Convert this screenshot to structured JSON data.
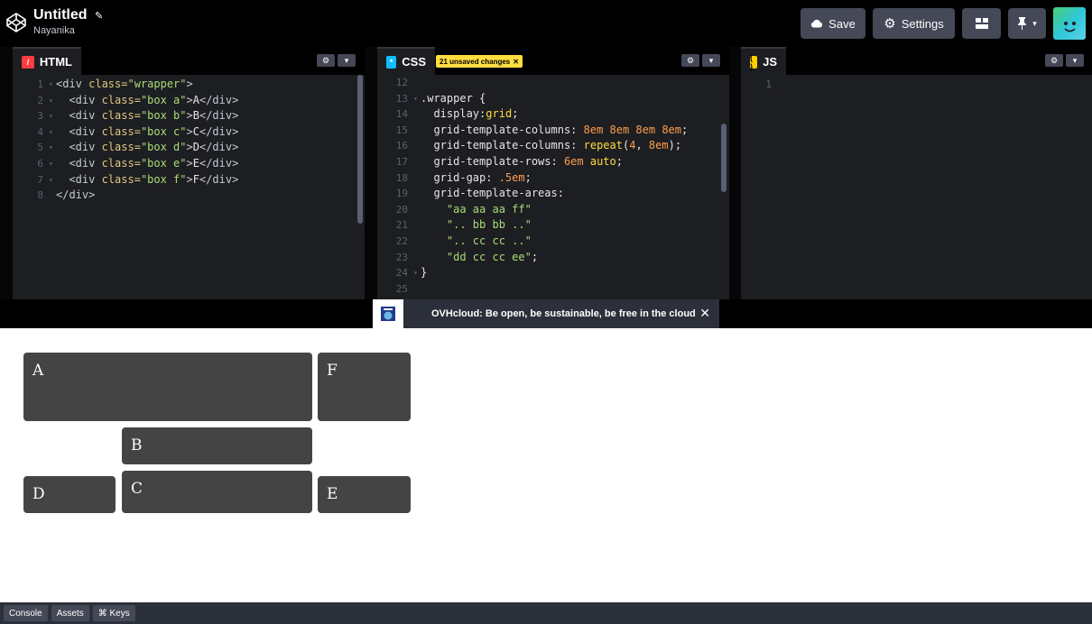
{
  "header": {
    "title": "Untitled",
    "edit_icon": "pencil-icon",
    "author": "Nayanika",
    "save_label": "Save",
    "settings_label": "Settings",
    "layout_icon": "layout-icon",
    "pin_icon": "pin-icon",
    "avatar": "user-avatar"
  },
  "editors": {
    "html": {
      "label": "HTML",
      "color": "#ff3c41",
      "lines": [
        {
          "n": "1",
          "fold": true,
          "parts": [
            [
              "tag",
              "<div "
            ],
            [
              "attr",
              "class="
            ],
            [
              "str",
              "\"wrapper\""
            ],
            [
              "tag",
              ">"
            ]
          ]
        },
        {
          "n": "2",
          "fold": true,
          "parts": [
            [
              "plain",
              "  "
            ],
            [
              "tag",
              "<div "
            ],
            [
              "attr",
              "class="
            ],
            [
              "str",
              "\"box a\""
            ],
            [
              "tag",
              ">"
            ],
            [
              "plain",
              "A"
            ],
            [
              "tag",
              "</div>"
            ]
          ]
        },
        {
          "n": "3",
          "fold": true,
          "parts": [
            [
              "plain",
              "  "
            ],
            [
              "tag",
              "<div "
            ],
            [
              "attr",
              "class="
            ],
            [
              "str",
              "\"box b\""
            ],
            [
              "tag",
              ">"
            ],
            [
              "plain",
              "B"
            ],
            [
              "tag",
              "</div>"
            ]
          ]
        },
        {
          "n": "4",
          "fold": true,
          "parts": [
            [
              "plain",
              "  "
            ],
            [
              "tag",
              "<div "
            ],
            [
              "attr",
              "class="
            ],
            [
              "str",
              "\"box c\""
            ],
            [
              "tag",
              ">"
            ],
            [
              "plain",
              "C"
            ],
            [
              "tag",
              "</div>"
            ]
          ]
        },
        {
          "n": "5",
          "fold": true,
          "parts": [
            [
              "plain",
              "  "
            ],
            [
              "tag",
              "<div "
            ],
            [
              "attr",
              "class="
            ],
            [
              "str",
              "\"box d\""
            ],
            [
              "tag",
              ">"
            ],
            [
              "plain",
              "D"
            ],
            [
              "tag",
              "</div>"
            ]
          ]
        },
        {
          "n": "6",
          "fold": true,
          "parts": [
            [
              "plain",
              "  "
            ],
            [
              "tag",
              "<div "
            ],
            [
              "attr",
              "class="
            ],
            [
              "str",
              "\"box e\""
            ],
            [
              "tag",
              ">"
            ],
            [
              "plain",
              "E"
            ],
            [
              "tag",
              "</div>"
            ]
          ]
        },
        {
          "n": "7",
          "fold": true,
          "parts": [
            [
              "plain",
              "  "
            ],
            [
              "tag",
              "<div "
            ],
            [
              "attr",
              "class="
            ],
            [
              "str",
              "\"box f\""
            ],
            [
              "tag",
              ">"
            ],
            [
              "plain",
              "F"
            ],
            [
              "tag",
              "</div>"
            ]
          ]
        },
        {
          "n": "8",
          "fold": false,
          "parts": [
            [
              "tag",
              "</div>"
            ]
          ]
        }
      ]
    },
    "css": {
      "label": "CSS",
      "color": "#0ebeff",
      "badge": "21 unsaved changes",
      "lines": [
        {
          "n": "12",
          "fold": false,
          "parts": []
        },
        {
          "n": "13",
          "fold": true,
          "parts": [
            [
              "sel",
              ".wrapper "
            ],
            [
              "plain",
              "{"
            ]
          ]
        },
        {
          "n": "14",
          "fold": false,
          "parts": [
            [
              "plain",
              "  "
            ],
            [
              "prop",
              "display"
            ],
            [
              "plain",
              ":"
            ],
            [
              "cssval",
              "grid"
            ],
            [
              "plain",
              ";"
            ]
          ]
        },
        {
          "n": "15",
          "fold": false,
          "parts": [
            [
              "plain",
              "  "
            ],
            [
              "prop",
              "grid-template-columns"
            ],
            [
              "plain",
              ": "
            ],
            [
              "num",
              "8em 8em 8em 8em"
            ],
            [
              "plain",
              ";"
            ]
          ]
        },
        {
          "n": "16",
          "fold": false,
          "parts": [
            [
              "plain",
              "  "
            ],
            [
              "prop",
              "grid-template-columns"
            ],
            [
              "plain",
              ": "
            ],
            [
              "cssval",
              "repeat"
            ],
            [
              "plain",
              "("
            ],
            [
              "num",
              "4"
            ],
            [
              "plain",
              ", "
            ],
            [
              "num",
              "8em"
            ],
            [
              "plain",
              ");"
            ]
          ]
        },
        {
          "n": "17",
          "fold": false,
          "parts": [
            [
              "plain",
              "  "
            ],
            [
              "prop",
              "grid-template-rows"
            ],
            [
              "plain",
              ": "
            ],
            [
              "num",
              "6em "
            ],
            [
              "cssval",
              "auto"
            ],
            [
              "plain",
              ";"
            ]
          ]
        },
        {
          "n": "18",
          "fold": false,
          "parts": [
            [
              "plain",
              "  "
            ],
            [
              "prop",
              "grid-gap"
            ],
            [
              "plain",
              ": "
            ],
            [
              "num",
              ".5em"
            ],
            [
              "plain",
              ";"
            ]
          ]
        },
        {
          "n": "19",
          "fold": false,
          "parts": [
            [
              "plain",
              "  "
            ],
            [
              "prop",
              "grid-template-areas"
            ],
            [
              "plain",
              ":"
            ]
          ]
        },
        {
          "n": "20",
          "fold": false,
          "parts": [
            [
              "plain",
              "    "
            ],
            [
              "str",
              "\"aa aa aa ff\""
            ]
          ]
        },
        {
          "n": "21",
          "fold": false,
          "parts": [
            [
              "plain",
              "    "
            ],
            [
              "str",
              "\".. bb bb ..\""
            ]
          ]
        },
        {
          "n": "22",
          "fold": false,
          "parts": [
            [
              "plain",
              "    "
            ],
            [
              "str",
              "\".. cc cc ..\""
            ]
          ]
        },
        {
          "n": "23",
          "fold": false,
          "parts": [
            [
              "plain",
              "    "
            ],
            [
              "str",
              "\"dd cc cc ee\""
            ],
            [
              "plain",
              ";"
            ]
          ]
        },
        {
          "n": "24",
          "fold": true,
          "parts": [
            [
              "plain",
              "}"
            ]
          ]
        },
        {
          "n": "25",
          "fold": false,
          "parts": []
        }
      ]
    },
    "js": {
      "label": "JS",
      "color": "#fcd000",
      "lines": [
        {
          "n": "1",
          "fold": false,
          "parts": []
        }
      ]
    }
  },
  "ad": {
    "text": "OVHcloud: Be open, be sustainable, be free in the cloud",
    "logo": "ovhcloud-logo"
  },
  "preview": {
    "boxes": [
      "A",
      "B",
      "C",
      "D",
      "E",
      "F"
    ]
  },
  "footer": {
    "console": "Console",
    "assets": "Assets",
    "keys": "⌘ Keys"
  }
}
